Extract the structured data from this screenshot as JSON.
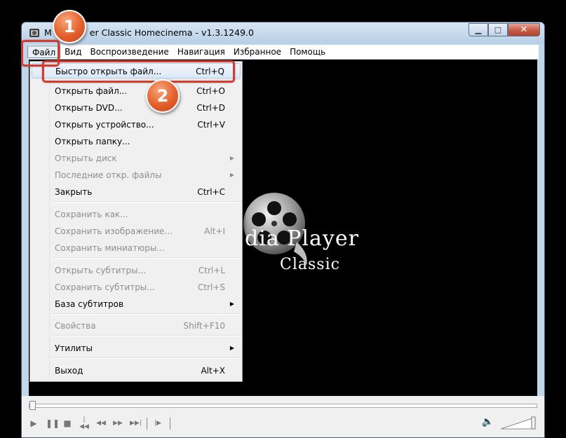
{
  "window": {
    "title": "Media Player Classic Homecinema - v1.3.1249.0",
    "title_visible": "er Classic Homecinema - v1.3.1249.0",
    "title_prefix": "M",
    "min_icon": "minimize-icon",
    "max_icon": "maximize-icon",
    "close_icon": "close-icon"
  },
  "menubar": {
    "items": [
      "Файл",
      "Вид",
      "Воспроизведение",
      "Навигация",
      "Избранное",
      "Помощь"
    ],
    "active": "Файл"
  },
  "file_menu": {
    "items": [
      {
        "label": "Быстро открыть файл...",
        "shortcut": "Ctrl+Q",
        "enabled": true,
        "highlighted": true
      },
      {
        "label": "Открыть файл...",
        "shortcut": "Ctrl+O",
        "enabled": true
      },
      {
        "label": "Открыть DVD...",
        "shortcut": "Ctrl+D",
        "enabled": true
      },
      {
        "label": "Открыть устройство...",
        "shortcut": "Ctrl+V",
        "enabled": true
      },
      {
        "label": "Открыть папку...",
        "shortcut": "",
        "enabled": true
      },
      {
        "label": "Открыть диск",
        "shortcut": "",
        "enabled": false,
        "submenu": true
      },
      {
        "label": "Последние откр. файлы",
        "shortcut": "",
        "enabled": false,
        "submenu": true
      },
      {
        "label": "Закрыть",
        "shortcut": "Ctrl+C",
        "enabled": true
      },
      {
        "label": "Сохранить как...",
        "shortcut": "",
        "enabled": false
      },
      {
        "label": "Сохранить изображение...",
        "shortcut": "Alt+I",
        "enabled": false
      },
      {
        "label": "Сохранить миниатюры...",
        "shortcut": "",
        "enabled": false
      },
      {
        "label": "Открыть субтитры...",
        "shortcut": "Ctrl+L",
        "enabled": false
      },
      {
        "label": "Сохранить субтитры...",
        "shortcut": "Ctrl+S",
        "enabled": false
      },
      {
        "label": "База субтитров",
        "shortcut": "",
        "enabled": true,
        "submenu": true
      },
      {
        "label": "Свойства",
        "shortcut": "Shift+F10",
        "enabled": false
      },
      {
        "label": "Утилиты",
        "shortcut": "",
        "enabled": true,
        "submenu": true
      },
      {
        "label": "Выход",
        "shortcut": "Alt+X",
        "enabled": true
      }
    ]
  },
  "logo": {
    "line1": "dia Player",
    "line2": "Classic"
  },
  "annotations": {
    "step1": "1",
    "step2": "2",
    "color": "#d63a2a"
  },
  "playback": {
    "buttons": [
      "play-icon",
      "pause-icon",
      "stop-icon",
      "skip-back-icon",
      "rewind-icon",
      "fast-forward-icon",
      "skip-forward-icon",
      "frame-step-icon"
    ],
    "volume_icon": "speaker-icon",
    "seek_position": 0
  }
}
